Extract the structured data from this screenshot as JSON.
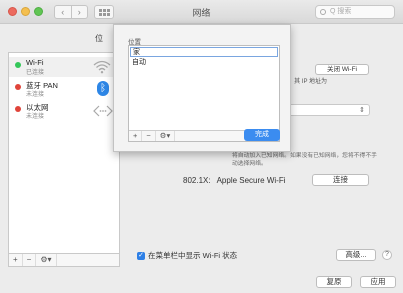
{
  "window": {
    "title": "网络"
  },
  "toolbar": {
    "back": "‹",
    "forward": "›",
    "search_placeholder": "Q 搜索"
  },
  "location": {
    "label": "位"
  },
  "sidebar": {
    "items": [
      {
        "name": "Wi-Fi",
        "status": "已连接",
        "dot_color": "#34c759"
      },
      {
        "name": "蓝牙 PAN",
        "status": "未连接",
        "dot_color": "#e0443a"
      },
      {
        "name": "以太网",
        "status": "未连接",
        "dot_color": "#e0443a"
      }
    ],
    "controls": {
      "add": "+",
      "remove": "−",
      "action": "⚙▾"
    }
  },
  "pane": {
    "turn_off_wifi": "关闭 Wi-Fi",
    "ip_text": "\"，其 IP 地址为",
    "hint": "将自动加入已知网络。如果没有已知网络，您将不得不手动选择网络。",
    "x802_label": "802.1X:",
    "x802_value": "Apple Secure Wi-Fi",
    "connect": "连接",
    "show_in_menu": "在菜单栏中显示 Wi-Fi 状态",
    "advanced": "高级...",
    "help": "?",
    "revert": "复原",
    "apply": "应用"
  },
  "sheet": {
    "header": "位置",
    "locations": [
      "家",
      "自动"
    ],
    "controls": {
      "add": "+",
      "remove": "−",
      "action": "⚙▾"
    },
    "done": "完成"
  }
}
